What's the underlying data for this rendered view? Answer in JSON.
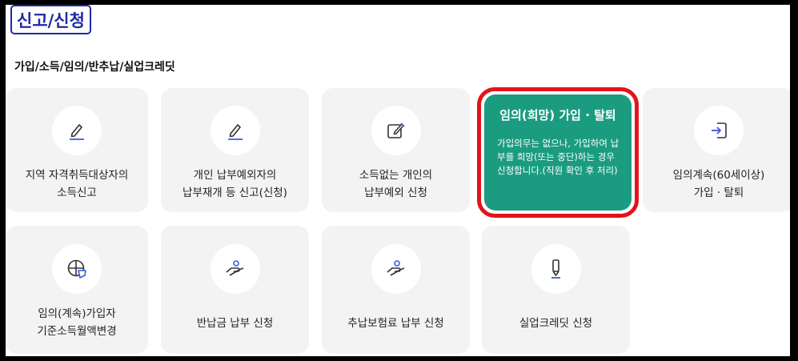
{
  "page": {
    "title": "신고/신청",
    "section_title": "가입/소득/임의/반추납/실업크레딧"
  },
  "cards_row1": [
    {
      "label": "지역 자격취득대상자의\n소득신고",
      "icon": "pencil-icon"
    },
    {
      "label": "개인 납부예외자의\n납부재개 등 신고(신청)",
      "icon": "pencil-icon"
    },
    {
      "label": "소득없는 개인의\n납부예외 신청",
      "icon": "edit-square-icon"
    }
  ],
  "highlight_card": {
    "title": "임의(희망) 가입 · 탈퇴",
    "description": "가입의무는 없으나, 가입하여 납부를 희망(또는 중단)하는 경우 신청합니다.(직원 확인 후 처리)"
  },
  "cards_row1_right": {
    "label": "임의계속(60세이상)\n가입 · 탈퇴",
    "icon": "login-icon"
  },
  "cards_row2": [
    {
      "label": "임의(계속)가입자\n기준소득월액변경",
      "icon": "pie-chart-icon"
    },
    {
      "label": "반납금 납부 신청",
      "icon": "hand-coin-icon"
    },
    {
      "label": "추납보험료 납부 신청",
      "icon": "hand-coin-icon"
    },
    {
      "label": "실업크레딧 신청",
      "icon": "pen-icon"
    }
  ],
  "colors": {
    "accent_blue": "#1f2aa8",
    "highlight_green": "#1b9c80",
    "highlight_border": "#e2141b",
    "icon_blue": "#3b5bdb"
  }
}
